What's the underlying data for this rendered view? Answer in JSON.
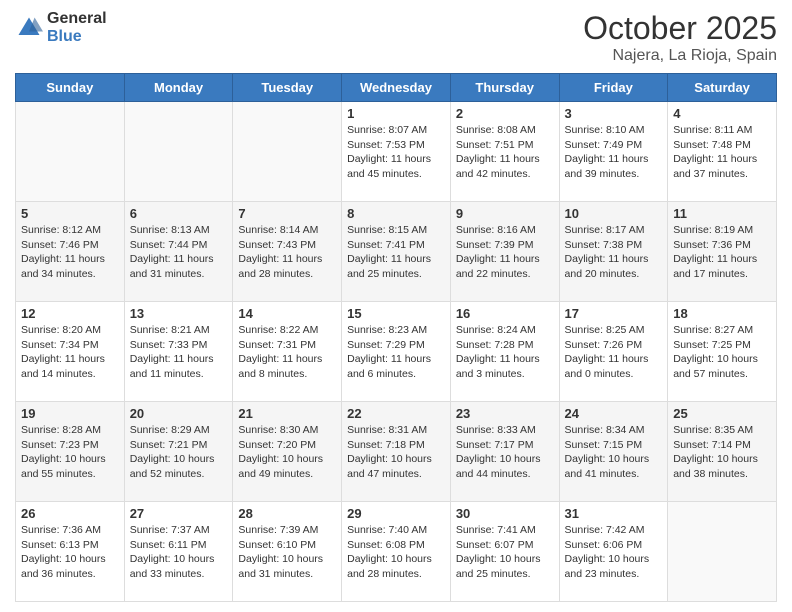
{
  "header": {
    "logo": {
      "general": "General",
      "blue": "Blue"
    },
    "title": "October 2025",
    "subtitle": "Najera, La Rioja, Spain"
  },
  "calendar": {
    "weekdays": [
      "Sunday",
      "Monday",
      "Tuesday",
      "Wednesday",
      "Thursday",
      "Friday",
      "Saturday"
    ],
    "weeks": [
      [
        {
          "day": "",
          "sunrise": "",
          "sunset": "",
          "daylight": ""
        },
        {
          "day": "",
          "sunrise": "",
          "sunset": "",
          "daylight": ""
        },
        {
          "day": "",
          "sunrise": "",
          "sunset": "",
          "daylight": ""
        },
        {
          "day": "1",
          "sunrise": "Sunrise: 8:07 AM",
          "sunset": "Sunset: 7:53 PM",
          "daylight": "Daylight: 11 hours and 45 minutes."
        },
        {
          "day": "2",
          "sunrise": "Sunrise: 8:08 AM",
          "sunset": "Sunset: 7:51 PM",
          "daylight": "Daylight: 11 hours and 42 minutes."
        },
        {
          "day": "3",
          "sunrise": "Sunrise: 8:10 AM",
          "sunset": "Sunset: 7:49 PM",
          "daylight": "Daylight: 11 hours and 39 minutes."
        },
        {
          "day": "4",
          "sunrise": "Sunrise: 8:11 AM",
          "sunset": "Sunset: 7:48 PM",
          "daylight": "Daylight: 11 hours and 37 minutes."
        }
      ],
      [
        {
          "day": "5",
          "sunrise": "Sunrise: 8:12 AM",
          "sunset": "Sunset: 7:46 PM",
          "daylight": "Daylight: 11 hours and 34 minutes."
        },
        {
          "day": "6",
          "sunrise": "Sunrise: 8:13 AM",
          "sunset": "Sunset: 7:44 PM",
          "daylight": "Daylight: 11 hours and 31 minutes."
        },
        {
          "day": "7",
          "sunrise": "Sunrise: 8:14 AM",
          "sunset": "Sunset: 7:43 PM",
          "daylight": "Daylight: 11 hours and 28 minutes."
        },
        {
          "day": "8",
          "sunrise": "Sunrise: 8:15 AM",
          "sunset": "Sunset: 7:41 PM",
          "daylight": "Daylight: 11 hours and 25 minutes."
        },
        {
          "day": "9",
          "sunrise": "Sunrise: 8:16 AM",
          "sunset": "Sunset: 7:39 PM",
          "daylight": "Daylight: 11 hours and 22 minutes."
        },
        {
          "day": "10",
          "sunrise": "Sunrise: 8:17 AM",
          "sunset": "Sunset: 7:38 PM",
          "daylight": "Daylight: 11 hours and 20 minutes."
        },
        {
          "day": "11",
          "sunrise": "Sunrise: 8:19 AM",
          "sunset": "Sunset: 7:36 PM",
          "daylight": "Daylight: 11 hours and 17 minutes."
        }
      ],
      [
        {
          "day": "12",
          "sunrise": "Sunrise: 8:20 AM",
          "sunset": "Sunset: 7:34 PM",
          "daylight": "Daylight: 11 hours and 14 minutes."
        },
        {
          "day": "13",
          "sunrise": "Sunrise: 8:21 AM",
          "sunset": "Sunset: 7:33 PM",
          "daylight": "Daylight: 11 hours and 11 minutes."
        },
        {
          "day": "14",
          "sunrise": "Sunrise: 8:22 AM",
          "sunset": "Sunset: 7:31 PM",
          "daylight": "Daylight: 11 hours and 8 minutes."
        },
        {
          "day": "15",
          "sunrise": "Sunrise: 8:23 AM",
          "sunset": "Sunset: 7:29 PM",
          "daylight": "Daylight: 11 hours and 6 minutes."
        },
        {
          "day": "16",
          "sunrise": "Sunrise: 8:24 AM",
          "sunset": "Sunset: 7:28 PM",
          "daylight": "Daylight: 11 hours and 3 minutes."
        },
        {
          "day": "17",
          "sunrise": "Sunrise: 8:25 AM",
          "sunset": "Sunset: 7:26 PM",
          "daylight": "Daylight: 11 hours and 0 minutes."
        },
        {
          "day": "18",
          "sunrise": "Sunrise: 8:27 AM",
          "sunset": "Sunset: 7:25 PM",
          "daylight": "Daylight: 10 hours and 57 minutes."
        }
      ],
      [
        {
          "day": "19",
          "sunrise": "Sunrise: 8:28 AM",
          "sunset": "Sunset: 7:23 PM",
          "daylight": "Daylight: 10 hours and 55 minutes."
        },
        {
          "day": "20",
          "sunrise": "Sunrise: 8:29 AM",
          "sunset": "Sunset: 7:21 PM",
          "daylight": "Daylight: 10 hours and 52 minutes."
        },
        {
          "day": "21",
          "sunrise": "Sunrise: 8:30 AM",
          "sunset": "Sunset: 7:20 PM",
          "daylight": "Daylight: 10 hours and 49 minutes."
        },
        {
          "day": "22",
          "sunrise": "Sunrise: 8:31 AM",
          "sunset": "Sunset: 7:18 PM",
          "daylight": "Daylight: 10 hours and 47 minutes."
        },
        {
          "day": "23",
          "sunrise": "Sunrise: 8:33 AM",
          "sunset": "Sunset: 7:17 PM",
          "daylight": "Daylight: 10 hours and 44 minutes."
        },
        {
          "day": "24",
          "sunrise": "Sunrise: 8:34 AM",
          "sunset": "Sunset: 7:15 PM",
          "daylight": "Daylight: 10 hours and 41 minutes."
        },
        {
          "day": "25",
          "sunrise": "Sunrise: 8:35 AM",
          "sunset": "Sunset: 7:14 PM",
          "daylight": "Daylight: 10 hours and 38 minutes."
        }
      ],
      [
        {
          "day": "26",
          "sunrise": "Sunrise: 7:36 AM",
          "sunset": "Sunset: 6:13 PM",
          "daylight": "Daylight: 10 hours and 36 minutes."
        },
        {
          "day": "27",
          "sunrise": "Sunrise: 7:37 AM",
          "sunset": "Sunset: 6:11 PM",
          "daylight": "Daylight: 10 hours and 33 minutes."
        },
        {
          "day": "28",
          "sunrise": "Sunrise: 7:39 AM",
          "sunset": "Sunset: 6:10 PM",
          "daylight": "Daylight: 10 hours and 31 minutes."
        },
        {
          "day": "29",
          "sunrise": "Sunrise: 7:40 AM",
          "sunset": "Sunset: 6:08 PM",
          "daylight": "Daylight: 10 hours and 28 minutes."
        },
        {
          "day": "30",
          "sunrise": "Sunrise: 7:41 AM",
          "sunset": "Sunset: 6:07 PM",
          "daylight": "Daylight: 10 hours and 25 minutes."
        },
        {
          "day": "31",
          "sunrise": "Sunrise: 7:42 AM",
          "sunset": "Sunset: 6:06 PM",
          "daylight": "Daylight: 10 hours and 23 minutes."
        },
        {
          "day": "",
          "sunrise": "",
          "sunset": "",
          "daylight": ""
        }
      ]
    ]
  }
}
